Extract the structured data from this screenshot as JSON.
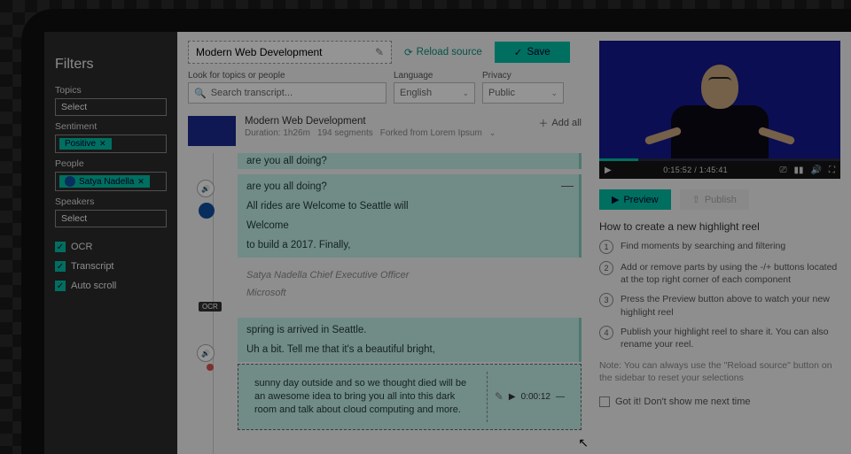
{
  "sidebar": {
    "title": "Filters",
    "topics_label": "Topics",
    "topics_value": "Select",
    "sentiment_label": "Sentiment",
    "sentiment_chip": "Positive",
    "people_label": "People",
    "people_chip": "Satya Nadella",
    "speakers_label": "Speakers",
    "speakers_value": "Select",
    "ocr_label": "OCR",
    "transcript_label": "Transcript",
    "autoscroll_label": "Auto scroll"
  },
  "header": {
    "title": "Modern Web Development",
    "reload": "Reload source",
    "save": "Save",
    "search_label": "Look for topics or people",
    "search_placeholder": "Search transcript...",
    "language_label": "Language",
    "language_value": "English",
    "privacy_label": "Privacy",
    "privacy_value": "Public"
  },
  "segment_header": {
    "title": "Modern Web Development",
    "duration": "Duration: 1h26m",
    "segments": "194 segments",
    "forked": "Forked from Lorem Ipsum",
    "add_all": "Add all"
  },
  "segments": {
    "cut": "are you all doing?",
    "s1_l1": "are you all doing?",
    "s1_l2": "All rides are Welcome to Seattle will",
    "s1_l3": "Welcome",
    "s1_l4": "to build a 2017. Finally,",
    "ocr_l1": "Satya Nadella Chief Executive Officer",
    "ocr_l2": "Microsoft",
    "s2_l1": "spring is arrived in Seattle.",
    "s2_l2": "Uh a bit. Tell me that it's a beautiful bright,",
    "active_text": "sunny day outside and so we thought died will be an awesome idea to bring you all into this dark room and talk about cloud computing and more.",
    "active_time": "0:00:12"
  },
  "ocr_badge": "OCR",
  "video": {
    "time": "0:15:52 / 1:45:41"
  },
  "actions": {
    "preview": "Preview",
    "publish": "Publish"
  },
  "howto": {
    "title": "How to create a new highlight reel",
    "s1": "Find moments by searching and filtering",
    "s2": "Add or remove parts by using the -/+ buttons located at the top right corner of each component",
    "s3": "Press the Preview button above to watch your new highlight reel",
    "s4": "Publish your highlight reel to share it. You can also rename your reel.",
    "note": "Note: You can always use the \"Reload source\" button on the sidebar to reset your selections",
    "gotit": "Got it! Don't show me next time"
  }
}
